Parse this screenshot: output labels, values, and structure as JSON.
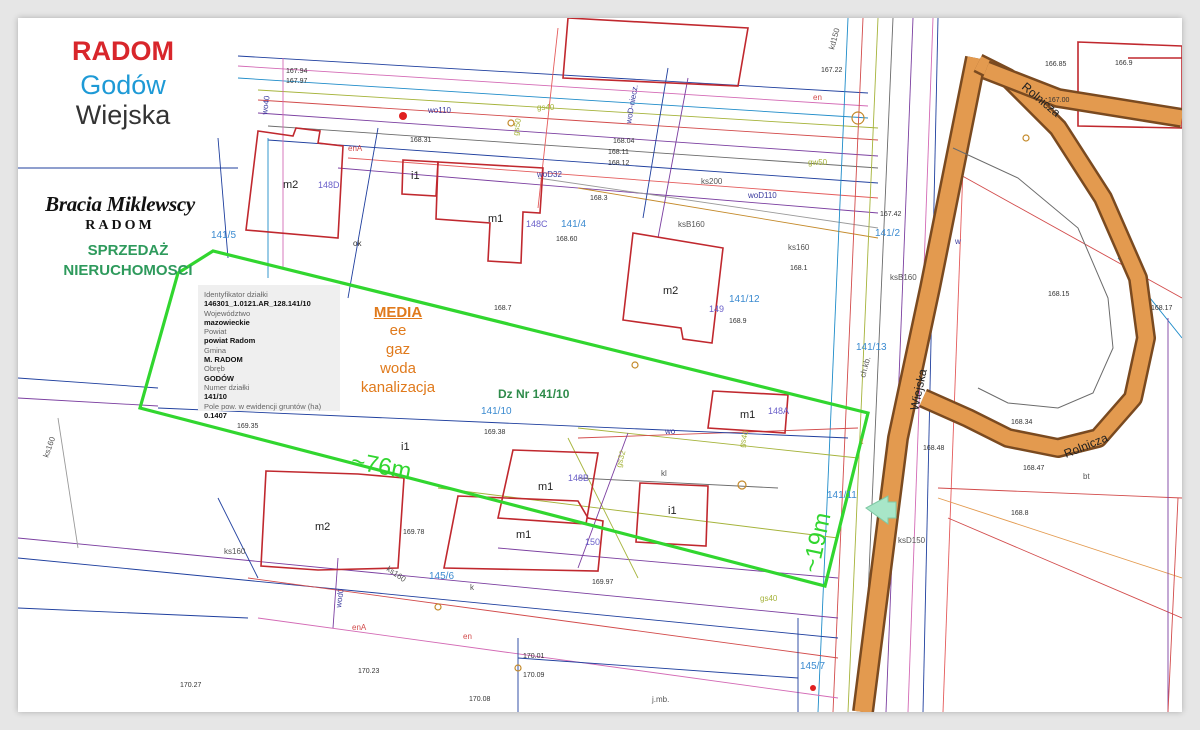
{
  "header": {
    "city": "RADOM",
    "district": "Godów",
    "street": "Wiejska"
  },
  "agency": {
    "name_line1": "Bracia Miklewscy",
    "name_line2": "RADOM",
    "tagline_line1": "SPRZEDAŻ",
    "tagline_line2": "NIERUCHOMOSCI"
  },
  "parcel_info": {
    "rows": [
      {
        "label": "Identyfikator działki",
        "value": "146301_1.0121.AR_128.141/10"
      },
      {
        "label": "Województwo",
        "value": "mazowieckie"
      },
      {
        "label": "Powiat",
        "value": "powiat Radom"
      },
      {
        "label": "Gmina",
        "value": "M. RADOM"
      },
      {
        "label": "Obręb",
        "value": "GODÓW"
      },
      {
        "label": "Numer działki",
        "value": "141/10"
      },
      {
        "label": "Pole pow. w ewidencji gruntów (ha)",
        "value": "0.1407"
      }
    ]
  },
  "media": {
    "title": "MEDIA",
    "items": [
      "ee",
      "gaz",
      "woda",
      "kanalizacja"
    ]
  },
  "plot": {
    "label": "Dz Nr 141/10",
    "length": "~76m",
    "width": "~19m"
  },
  "colors": {
    "plot_outline": "#31d62f",
    "road": "#e39a4f",
    "city": "#d8262b",
    "district": "#1e9ad6",
    "sales": "#2e9a5c",
    "media": "#e07a1c",
    "building": "#c0282e"
  },
  "streets": {
    "street_1": "Wiejska",
    "street_2": "Rolnicza",
    "street_3": "Rolnicza"
  },
  "buildings": [
    {
      "label": "m2"
    },
    {
      "label": "i1"
    },
    {
      "label": "m1"
    },
    {
      "label": "m2"
    },
    {
      "label": "m1"
    },
    {
      "label": "m1"
    },
    {
      "label": "i1"
    },
    {
      "label": "m2"
    },
    {
      "label": "m1"
    },
    {
      "label": "i1"
    }
  ],
  "house_numbers": [
    "148D",
    "148C",
    "149",
    "148A",
    "148B",
    "150"
  ],
  "parcels": [
    "141/5",
    "141/4",
    "141/12",
    "141/10",
    "145/6",
    "141/2",
    "141/13",
    "141/11",
    "145/7"
  ],
  "elevations": [
    "167.94",
    "167.97",
    "168.31",
    "168.04",
    "168.11",
    "168.12",
    "168.3",
    "168.60",
    "168.7",
    "168.9",
    "168.1",
    "167.22",
    "166.85",
    "166.9",
    "167.00",
    "169.35",
    "169.38",
    "169.78",
    "169.97",
    "170.01",
    "170.09",
    "170.27",
    "170.23",
    "170.08",
    "168.15",
    "168.17",
    "168.34",
    "168.47",
    "168.8",
    "168.48",
    "167.42"
  ],
  "utility_lines": [
    "wo40",
    "wo110",
    "woD-niecz.",
    "woD32",
    "woD110",
    "gs40",
    "gs50",
    "gw50",
    "ks200",
    "ksB160",
    "ks160",
    "ksB160",
    "enA",
    "en",
    "ok",
    "kd150",
    "gs40",
    "gs32",
    "wo",
    "kl",
    "ks160",
    "ks160",
    "wod0",
    "enA",
    "en",
    "ks160",
    "gs40",
    "ksD150",
    "ch.kb.",
    "j.mb.",
    "bt",
    "w",
    "k",
    "t"
  ]
}
